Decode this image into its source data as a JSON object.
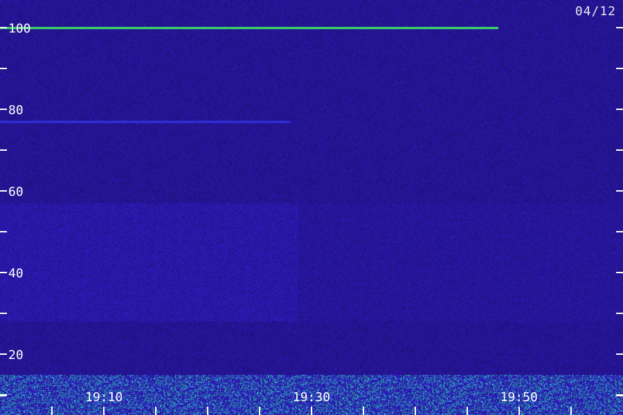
{
  "chart_data": {
    "type": "heatmap",
    "title": "",
    "date_label": "04/12",
    "y_axis": {
      "range": [
        0,
        110
      ],
      "tick_labels": [
        "20",
        "40",
        "60",
        "80",
        "100"
      ],
      "tick_values": [
        20,
        40,
        60,
        80,
        100
      ],
      "minor_tick_values": [
        10,
        30,
        50,
        70,
        90
      ]
    },
    "x_axis": {
      "tick_labels": [
        "19:10",
        "19:30",
        "19:50"
      ],
      "tick_positions_fraction": [
        0.167,
        0.5,
        0.833
      ],
      "minor_tick_count": 12
    },
    "features": [
      {
        "name": "horizontal line",
        "level": 100,
        "color": "#40ff60"
      },
      {
        "name": "horizontal line",
        "level": 77,
        "color": "#3a3dff"
      },
      {
        "name": "band",
        "level_range": [
          30,
          55
        ],
        "color": "#2a2ad0"
      },
      {
        "name": "noise floor",
        "level_range": [
          0,
          15
        ],
        "color": "#30d090"
      }
    ],
    "colors": {
      "background": "#1a0f5e",
      "low": "#1c0c55",
      "mid": "#2d2ee8",
      "high": "#40ff60",
      "axis": "#ffffff"
    }
  }
}
